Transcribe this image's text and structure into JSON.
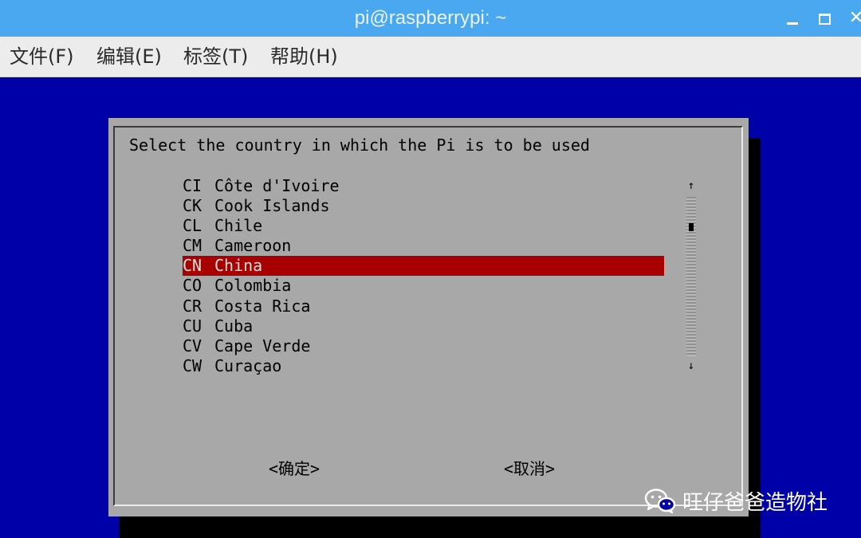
{
  "window": {
    "title": "pi@raspberrypi: ~"
  },
  "menu": [
    "文件(F)",
    "编辑(E)",
    "标签(T)",
    "帮助(H)"
  ],
  "dialog": {
    "prompt": "Select the country in which the Pi is to be used",
    "countries": [
      {
        "code": "CI",
        "name": "Côte d'Ivoire"
      },
      {
        "code": "CK",
        "name": "Cook Islands"
      },
      {
        "code": "CL",
        "name": "Chile"
      },
      {
        "code": "CM",
        "name": "Cameroon"
      },
      {
        "code": "CN",
        "name": "China",
        "selected": true
      },
      {
        "code": "CO",
        "name": "Colombia"
      },
      {
        "code": "CR",
        "name": "Costa Rica"
      },
      {
        "code": "CU",
        "name": "Cuba"
      },
      {
        "code": "CV",
        "name": "Cape Verde"
      },
      {
        "code": "CW",
        "name": "Curaçao"
      }
    ],
    "ok_label": "<确定>",
    "cancel_label": "<取消>"
  },
  "watermark": {
    "text": "旺仔爸爸造物社",
    "icon": "wechat-icon"
  },
  "colors": {
    "titlebar": "#4aa8f0",
    "terminal_bg": "#0000a8",
    "dialog_bg": "#a8a8a8",
    "selection": "#a80000"
  }
}
